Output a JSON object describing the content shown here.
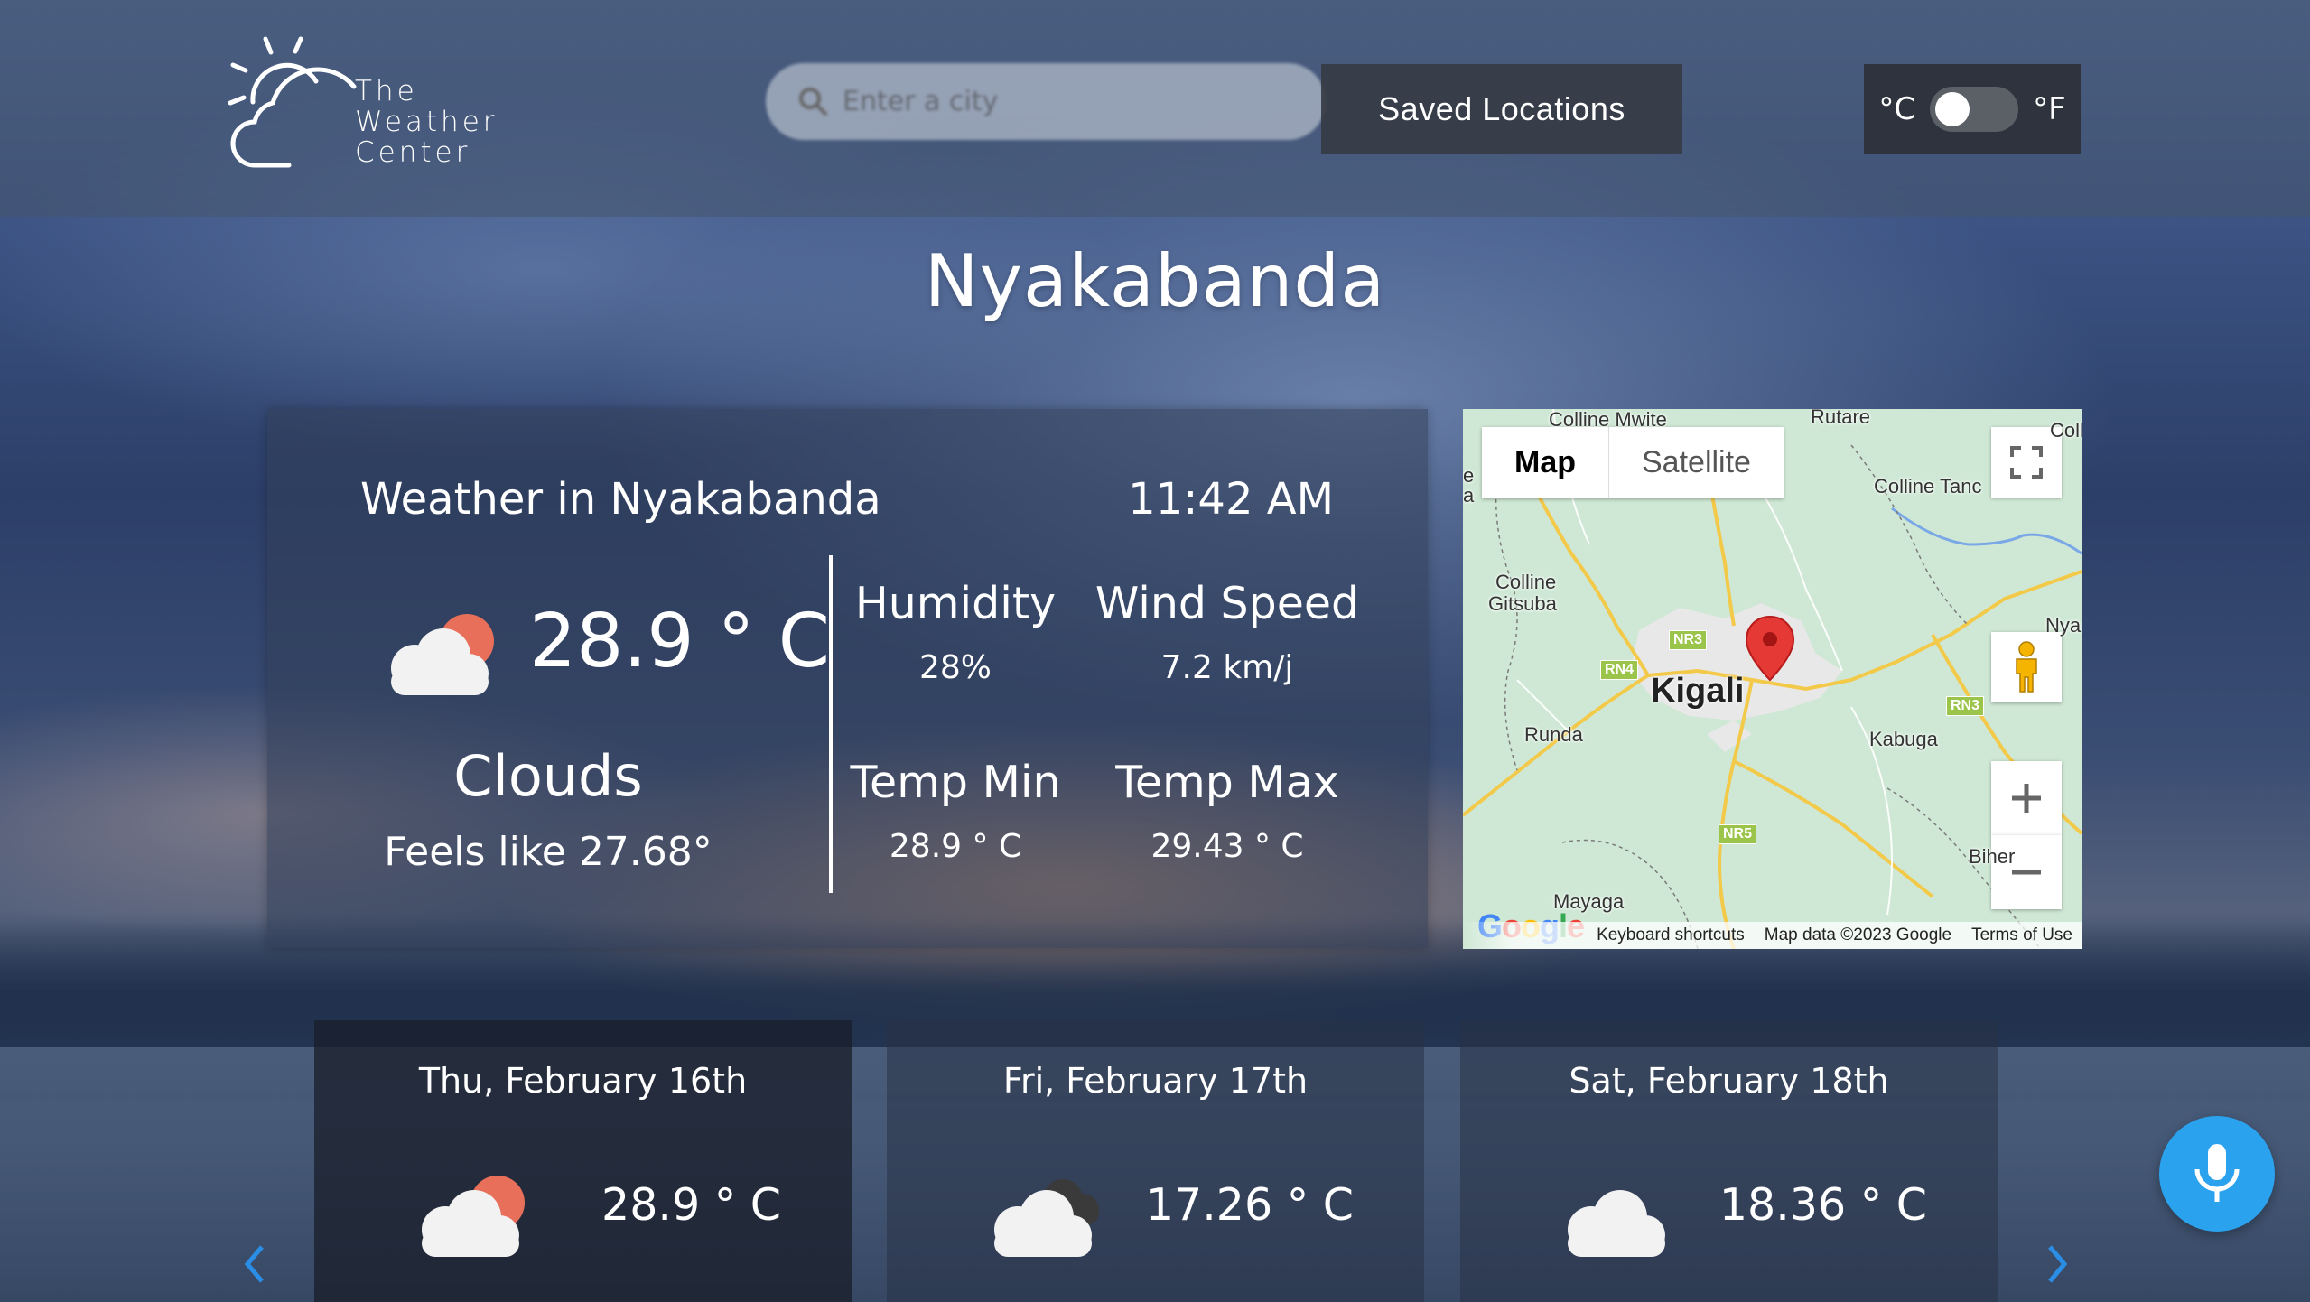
{
  "header": {
    "logo_lines": [
      "The",
      "Weather",
      "Center"
    ],
    "search": {
      "placeholder": "Enter a city",
      "icon": "search-icon"
    },
    "saved_locations_label": "Saved Locations",
    "unit_toggle": {
      "celsius_label": "°C",
      "fahrenheit_label": "°F",
      "selected": "°C"
    }
  },
  "city": "Nyakabanda",
  "current": {
    "title": "Weather in Nyakabanda",
    "time": "11:42 AM",
    "icon": "cloud-sun-icon",
    "temperature": "28.9 ° C",
    "condition": "Clouds",
    "feels_like": "Feels like 27.68°",
    "stats": {
      "humidity_label": "Humidity",
      "humidity_value": "28%",
      "wind_label": "Wind Speed",
      "wind_value": "7.2 km/j",
      "temp_min_label": "Temp Min",
      "temp_min_value": "28.9 ° C",
      "temp_max_label": "Temp Max",
      "temp_max_value": "29.43 ° C"
    }
  },
  "map": {
    "tab_map": "Map",
    "tab_satellite": "Satellite",
    "labels": {
      "colline_mwite": "Colline Mwite",
      "rutare": "Rutare",
      "colline_top_right": "Colline",
      "colline_tanda": "Colline Tanc",
      "colline_gitsuba_1": "Colline",
      "colline_gitsuba_2": "Gitsuba",
      "nya": "Nya",
      "kigali": "Kigali",
      "runda": "Runda",
      "kabuga": "Kabuga",
      "bihe": "Biher",
      "mayaga": "Mayaga",
      "edge_e": "e",
      "edge_a": "a"
    },
    "roads": {
      "nr3": "NR3",
      "rn4": "RN4",
      "rn3": "RN3",
      "nr5": "NR5"
    },
    "footer": {
      "keyboard": "Keyboard shortcuts",
      "data": "Map data ©2023 Google",
      "terms": "Terms of Use"
    },
    "google": "Google",
    "colors": {
      "water": "#7aa7e6",
      "roads": "#f3c94a",
      "urban": "#e8e8e8",
      "pin": "#e53935"
    }
  },
  "forecast": [
    {
      "date": "Thu, February 16th",
      "temp": "28.9 ° C",
      "icon": "cloud-sun-icon"
    },
    {
      "date": "Fri, February 17th",
      "temp": "17.26 ° C",
      "icon": "dark-clouds-icon"
    },
    {
      "date": "Sat, February 18th",
      "temp": "18.36 ° C",
      "icon": "cloud-icon"
    }
  ],
  "colors": {
    "mic": "#2ba2ee",
    "arrow": "#2b8ee6",
    "sun": "#e8705a"
  }
}
